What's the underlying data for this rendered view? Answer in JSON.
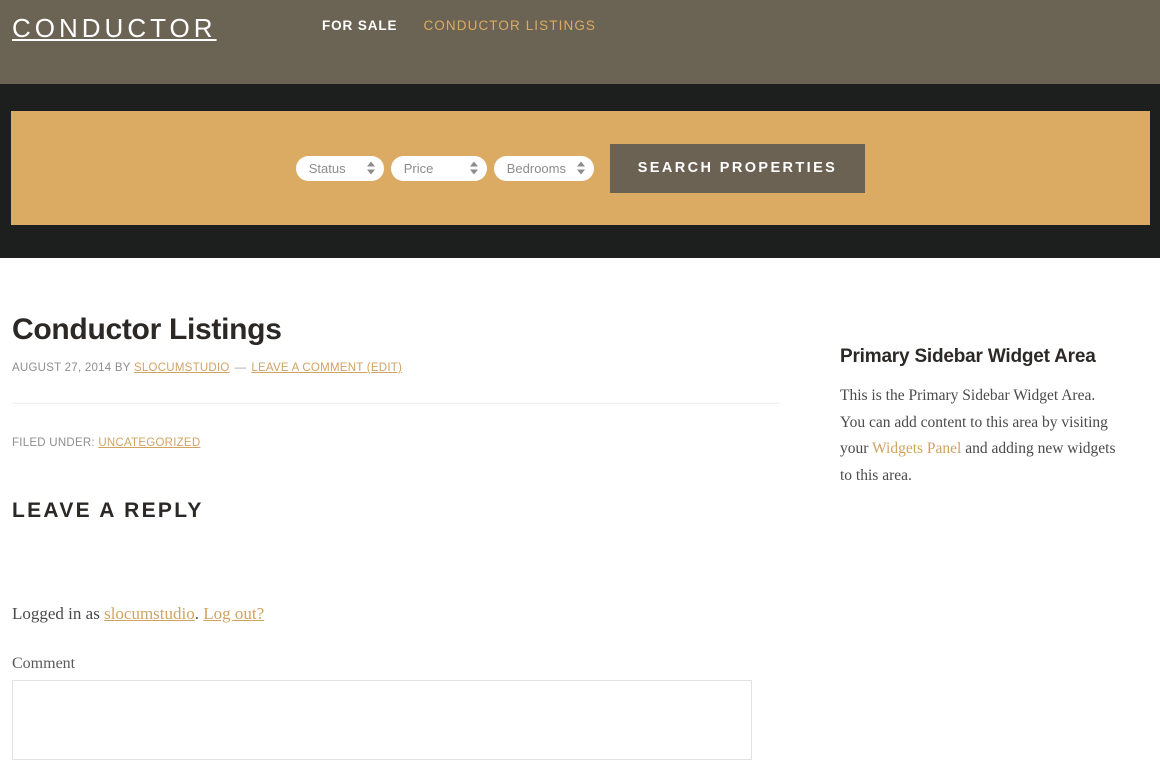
{
  "header": {
    "site_title": "CONDUCTOR",
    "nav": [
      {
        "label": "FOR SALE",
        "state": "default"
      },
      {
        "label": "CONDUCTOR LISTINGS",
        "state": "active"
      }
    ],
    "bg_color": "#6b6353"
  },
  "search": {
    "band_bg": "#1d1f1f",
    "panel_bg": "#dcab63",
    "fields": [
      {
        "name": "status",
        "selected": "Status"
      },
      {
        "name": "price",
        "selected": "Price"
      },
      {
        "name": "bedrooms",
        "selected": "Bedrooms"
      }
    ],
    "submit_label": "SEARCH PROPERTIES",
    "submit_bg": "#6b6254"
  },
  "post": {
    "title": "Conductor Listings",
    "meta": {
      "date_by": "AUGUST 27, 2014 BY ",
      "author": "SLOCUMSTUDIO",
      "separator": "—",
      "comment_link": "LEAVE A COMMENT (EDIT)"
    },
    "footer": {
      "filed_under_label": "FILED UNDER: ",
      "category": "UNCATEGORIZED"
    }
  },
  "comments": {
    "reply_title": "LEAVE A REPLY",
    "logged_in_prefix": "Logged in as ",
    "logged_in_user": "slocumstudio",
    "logged_in_period": ". ",
    "logout_label": "Log out?",
    "comment_label": "Comment",
    "comment_value": "",
    "comment_placeholder": ""
  },
  "sidebar": {
    "widget_title": "Primary Sidebar Widget Area",
    "widget_text_before": "This is the Primary Sidebar Widget Area. You can add content to this area by visiting your ",
    "widget_link": "Widgets Panel",
    "widget_text_after": " and adding new widgets to this area."
  },
  "colors": {
    "accent_tan": "#dcab63",
    "link_tan": "#d1a362",
    "dark": "#1d1f1f",
    "brown": "#6b6353",
    "text_dark": "#2b2825"
  }
}
